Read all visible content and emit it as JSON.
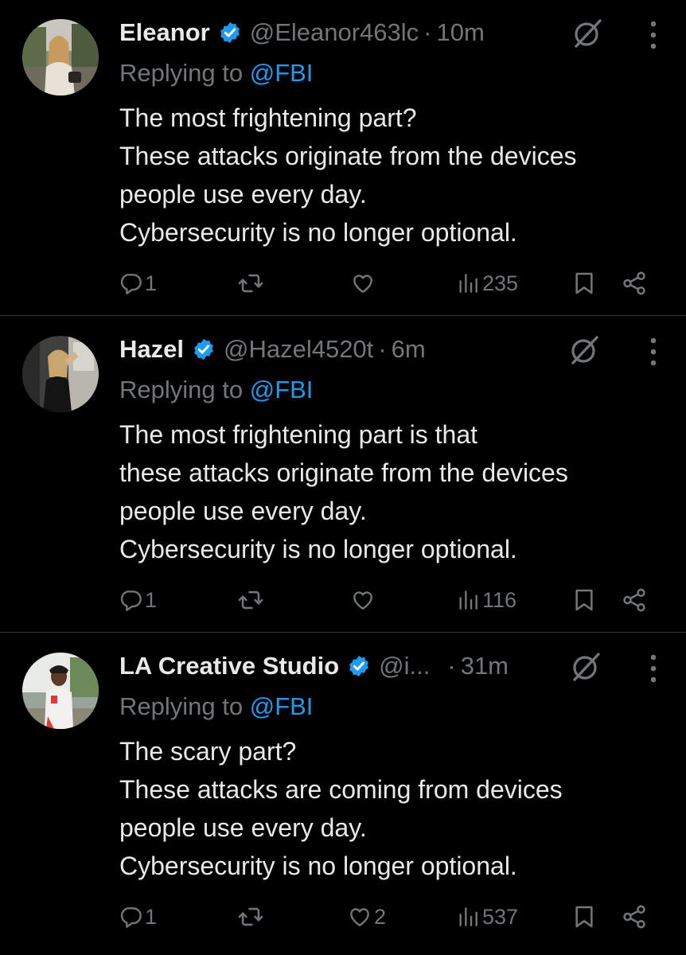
{
  "tweets": [
    {
      "name": "Eleanor",
      "handle": "@Eleanor463lc",
      "separator": "·",
      "time": "10m",
      "replying_prefix": "Replying to ",
      "replying_mention": "@FBI",
      "lines": [
        "The most frightening part?",
        "These attacks originate from the devices",
        "people use every day.",
        "Cybersecurity is no longer optional."
      ],
      "reply_count": "1",
      "retweet_count": "",
      "like_count": "",
      "view_count": "235",
      "avatar": "woman-in-park-photo"
    },
    {
      "name": "Hazel",
      "handle": "@Hazel4520t",
      "separator": "·",
      "time": "6m",
      "replying_prefix": "Replying to ",
      "replying_mention": "@FBI",
      "lines": [
        "The most frightening part is that",
        "these attacks originate from the devices",
        "people use every day.",
        "Cybersecurity is no longer optional."
      ],
      "reply_count": "1",
      "retweet_count": "",
      "like_count": "",
      "view_count": "116",
      "avatar": "woman-street-photo"
    },
    {
      "name": "LA Creative Studio",
      "handle": "@i...",
      "separator": "·",
      "time": "31m",
      "replying_prefix": "Replying to ",
      "replying_mention": "@FBI",
      "lines": [
        "The scary part?",
        "These attacks are coming from devices",
        "people use every day.",
        "Cybersecurity is no longer optional."
      ],
      "reply_count": "1",
      "retweet_count": "",
      "like_count": "2",
      "view_count": "537",
      "avatar": "man-outdoors-photo"
    }
  ],
  "colors": {
    "background": "#000000",
    "text": "#e7e9ea",
    "secondary": "#71767b",
    "accent": "#1d9bf0",
    "divider": "#2f3336"
  },
  "icons": [
    "verified-badge-icon",
    "grok-icon",
    "more-icon",
    "reply-icon",
    "retweet-icon",
    "like-icon",
    "views-icon",
    "bookmark-icon",
    "share-icon"
  ]
}
